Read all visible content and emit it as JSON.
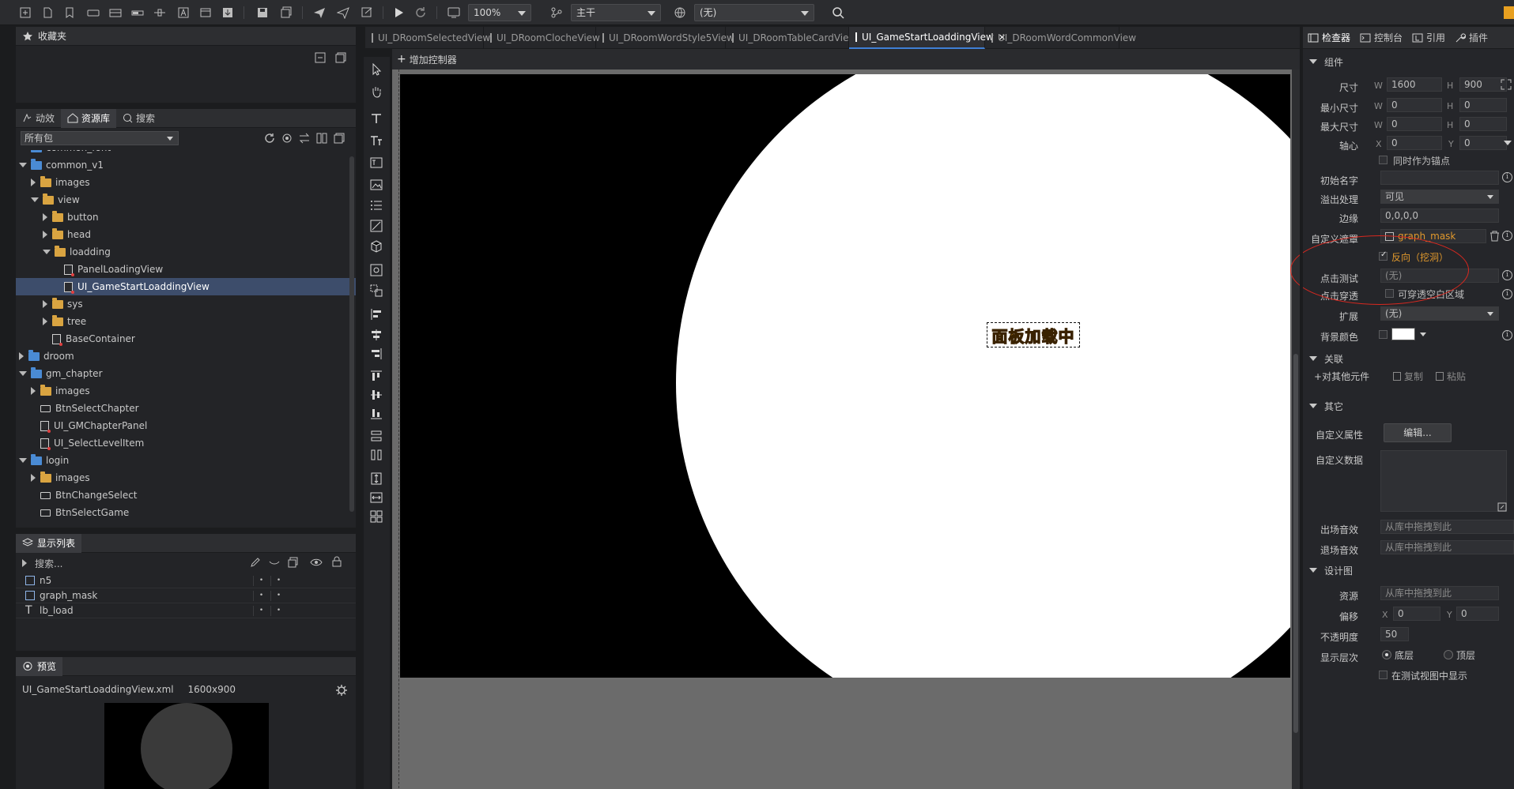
{
  "toolbar": {
    "zoom": "100%",
    "branch": "主干",
    "language": "(无)"
  },
  "favorites": {
    "title": "收藏夹"
  },
  "library": {
    "tabs": [
      "动效",
      "资源库",
      "搜索"
    ],
    "package_filter": "所有包",
    "tree": [
      {
        "label": "common_font",
        "depth": 0,
        "kind": "pkg",
        "expand": "down"
      },
      {
        "label": "common_v1",
        "depth": 0,
        "kind": "pkg",
        "expand": "down"
      },
      {
        "label": "images",
        "depth": 1,
        "kind": "folder",
        "expand": "right"
      },
      {
        "label": "view",
        "depth": 1,
        "kind": "folder",
        "expand": "down"
      },
      {
        "label": "button",
        "depth": 2,
        "kind": "folder",
        "expand": "right"
      },
      {
        "label": "head",
        "depth": 2,
        "kind": "folder",
        "expand": "right"
      },
      {
        "label": "loadding",
        "depth": 2,
        "kind": "folder",
        "expand": "down"
      },
      {
        "label": "PanelLoadingView",
        "depth": 3,
        "kind": "doc",
        "expand": "none"
      },
      {
        "label": "UI_GameStartLoaddingView",
        "depth": 3,
        "kind": "doc",
        "expand": "none",
        "selected": true
      },
      {
        "label": "sys",
        "depth": 2,
        "kind": "folder",
        "expand": "right"
      },
      {
        "label": "tree",
        "depth": 2,
        "kind": "folder",
        "expand": "right"
      },
      {
        "label": "BaseContainer",
        "depth": 2,
        "kind": "doc",
        "expand": "none"
      },
      {
        "label": "droom",
        "depth": 0,
        "kind": "pkg",
        "expand": "right"
      },
      {
        "label": "gm_chapter",
        "depth": 0,
        "kind": "pkg",
        "expand": "down"
      },
      {
        "label": "images",
        "depth": 1,
        "kind": "folder",
        "expand": "right"
      },
      {
        "label": "BtnSelectChapter",
        "depth": 1,
        "kind": "btn",
        "expand": "none"
      },
      {
        "label": "UI_GMChapterPanel",
        "depth": 1,
        "kind": "doc",
        "expand": "none"
      },
      {
        "label": "UI_SelectLevelItem",
        "depth": 1,
        "kind": "doc",
        "expand": "none"
      },
      {
        "label": "login",
        "depth": 0,
        "kind": "pkg",
        "expand": "down"
      },
      {
        "label": "images",
        "depth": 1,
        "kind": "folder",
        "expand": "right"
      },
      {
        "label": "BtnChangeSelect",
        "depth": 1,
        "kind": "btn",
        "expand": "none"
      },
      {
        "label": "BtnSelectGame",
        "depth": 1,
        "kind": "btn",
        "expand": "none"
      }
    ]
  },
  "display_list": {
    "title": "显示列表",
    "search_placeholder": "搜索...",
    "items": [
      {
        "label": "n5",
        "kind": "img"
      },
      {
        "label": "graph_mask",
        "kind": "img"
      },
      {
        "label": "lb_load",
        "kind": "text"
      }
    ]
  },
  "preview": {
    "title": "预览",
    "file": "UI_GameStartLoaddingView.xml",
    "size": "1600x900"
  },
  "doc_tabs": [
    {
      "label": "UI_DRoomSelectedView",
      "active": false
    },
    {
      "label": "UI_DRoomClocheView",
      "active": false
    },
    {
      "label": "UI_DRoomWordStyle5View",
      "active": false
    },
    {
      "label": "UI_DRoomTableCardView",
      "active": false
    },
    {
      "label": "UI_GameStartLoaddingView",
      "active": true
    },
    {
      "label": "UI_DRoomWordCommonView",
      "active": false
    }
  ],
  "stage": {
    "add_controller": "增加控制器",
    "loading_text": "面板加载中"
  },
  "inspector": {
    "tabs": [
      "检查器",
      "控制台",
      "引用",
      "插件"
    ],
    "section_component": "组件",
    "size_label": "尺寸",
    "size_w": "1600",
    "size_h": "900",
    "min_label": "最小尺寸",
    "min_w": "0",
    "min_h": "0",
    "max_label": "最大尺寸",
    "max_w": "0",
    "max_h": "0",
    "pivot_label": "轴心",
    "pivot_x": "0",
    "pivot_y": "0",
    "pivot_anchor": "同时作为锚点",
    "init_name_label": "初始名字",
    "init_name": "",
    "overflow_label": "溢出处理",
    "overflow": "可见",
    "margin_label": "边缘",
    "margin": "0,0,0,0",
    "mask_label": "自定义遮罩",
    "mask_value": "graph_mask",
    "reverse_label": "反向（挖洞）",
    "hittest_label": "点击测试",
    "hittest_value": "(无)",
    "through_label": "点击穿透",
    "through_value": "可穿透空白区域",
    "extend_label": "扩展",
    "extend_value": "(无)",
    "bg_color_label": "背景颜色",
    "section_relation": "关联",
    "rel_other": "对其他元件",
    "rel_copy": "复制",
    "rel_paste": "粘贴",
    "section_other": "其它",
    "custom_prop_label": "自定义属性",
    "edit_button": "编辑...",
    "custom_data_label": "自定义数据",
    "enter_sound_label": "出场音效",
    "enter_sound": "从库中拖拽到此",
    "exit_sound_label": "退场音效",
    "exit_sound": "从库中拖拽到此",
    "section_design": "设计图",
    "res_label": "资源",
    "res_value": "从库中拖拽到此",
    "offset_label": "偏移",
    "offset_x": "0",
    "offset_y": "0",
    "opacity_label": "不透明度",
    "opacity": "50",
    "layer_label": "显示层次",
    "layer_bottom": "底层",
    "layer_top": "顶层",
    "show_in_test": "在测试视图中显示"
  },
  "colors": {
    "accent": "#3f7fd6",
    "mask_orange": "#e0982c",
    "annotation_red": "#d8281f",
    "stage_black": "#000000",
    "stage_gray": "#6b6b6b"
  }
}
